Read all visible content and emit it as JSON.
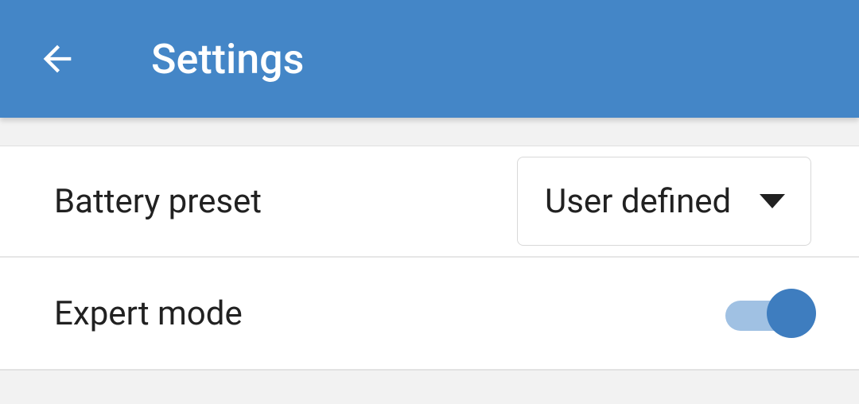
{
  "header": {
    "title": "Settings"
  },
  "rows": {
    "battery_preset": {
      "label": "Battery preset",
      "selected": "User defined"
    },
    "expert_mode": {
      "label": "Expert mode",
      "enabled": true
    }
  },
  "colors": {
    "appbar": "#4486c7",
    "toggle_thumb": "#3e7dbf",
    "toggle_track": "#a0c1e3"
  }
}
